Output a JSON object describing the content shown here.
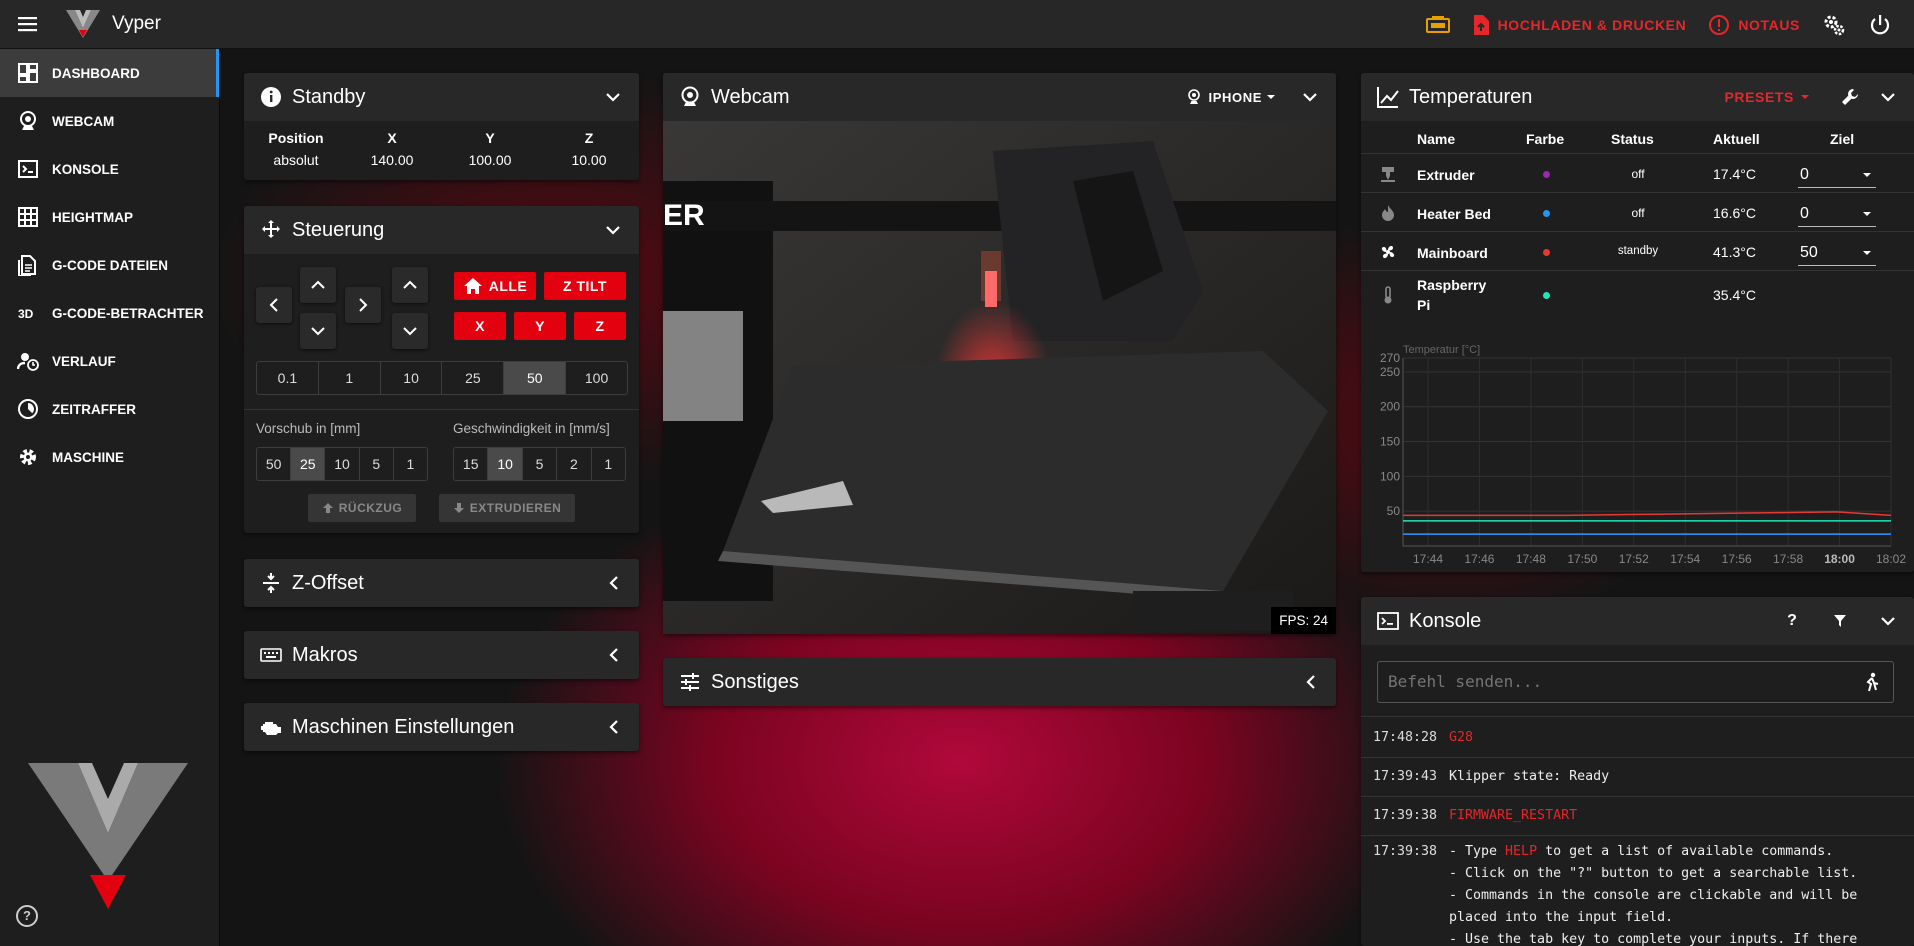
{
  "app": {
    "title": "Vyper"
  },
  "topbar": {
    "upload_print": "HOCHLADEN & DRUCKEN",
    "emergency": "NOTAUS"
  },
  "sidebar": {
    "items": [
      {
        "label": "DASHBOARD",
        "icon": "dashboard-icon"
      },
      {
        "label": "WEBCAM",
        "icon": "webcam-icon"
      },
      {
        "label": "KONSOLE",
        "icon": "console-icon"
      },
      {
        "label": "HEIGHTMAP",
        "icon": "grid-icon"
      },
      {
        "label": "G-CODE DATEIEN",
        "icon": "file-icon"
      },
      {
        "label": "G-CODE-BETRACHTER",
        "icon": "3d-icon"
      },
      {
        "label": "VERLAUF",
        "icon": "history-icon"
      },
      {
        "label": "ZEITRAFFER",
        "icon": "timelapse-icon"
      },
      {
        "label": "MASCHINE",
        "icon": "gear-icon"
      }
    ]
  },
  "standby": {
    "title": "Standby",
    "headers": [
      "Position",
      "X",
      "Y",
      "Z"
    ],
    "values": [
      "absolut",
      "140.00",
      "100.00",
      "10.00"
    ]
  },
  "steuerung": {
    "title": "Steuerung",
    "home_all": "ALLE",
    "z_tilt": "Z TILT",
    "x": "X",
    "y": "Y",
    "z": "Z",
    "steps": [
      "0.1",
      "1",
      "10",
      "25",
      "50",
      "100"
    ],
    "steps_selected": "50",
    "feed_label": "Vorschub in [mm]",
    "feed": [
      "50",
      "25",
      "10",
      "5",
      "1"
    ],
    "feed_selected": "25",
    "speed_label": "Geschwindigkeit in [mm/s]",
    "speed": [
      "15",
      "10",
      "5",
      "2",
      "1"
    ],
    "speed_selected": "10",
    "retract": "RÜCKZUG",
    "extrude": "EXTRUDIEREN"
  },
  "zoffset": {
    "title": "Z-Offset"
  },
  "makros": {
    "title": "Makros"
  },
  "machine_settings": {
    "title": "Maschinen Einstellungen"
  },
  "webcam": {
    "title": "Webcam",
    "camera": "IPHONE",
    "fps": "FPS: 24"
  },
  "sonstiges": {
    "title": "Sonstiges"
  },
  "temps": {
    "title": "Temperaturen",
    "presets": "PRESETS",
    "headers": [
      "Name",
      "Farbe",
      "Status",
      "Aktuell",
      "Ziel"
    ],
    "rows": [
      {
        "name": "Extruder",
        "color": "#9c27b0",
        "status": "off",
        "current": "17.4°C",
        "target": "0"
      },
      {
        "name": "Heater Bed",
        "color": "#2196f3",
        "status": "off",
        "current": "16.6°C",
        "target": "0"
      },
      {
        "name": "Mainboard",
        "color": "#e53935",
        "status": "standby",
        "current": "41.3°C",
        "target": "50"
      },
      {
        "name": "Raspberry Pi",
        "color": "#1de9b6",
        "status": "",
        "current": "35.4°C",
        "target": ""
      }
    ]
  },
  "chart_data": {
    "type": "line",
    "ylabel": "Temperatur [°C]",
    "ylim": [
      0,
      270
    ],
    "yticks": [
      "270",
      "250",
      "200",
      "150",
      "100",
      "50"
    ],
    "xticks": [
      "17:44",
      "17:46",
      "17:48",
      "17:50",
      "17:52",
      "17:54",
      "17:56",
      "17:58",
      "18:00",
      "18:02"
    ],
    "series": [
      {
        "name": "Mainboard",
        "color": "#e53935",
        "values": [
          44,
          44,
          44,
          44,
          45,
          46,
          47,
          48,
          49,
          44
        ]
      },
      {
        "name": "Raspberry Pi",
        "color": "#1de9b6",
        "values": [
          36,
          36,
          36,
          36,
          36,
          36,
          36,
          36,
          36,
          36
        ]
      },
      {
        "name": "Extruder",
        "color": "#9c27b0",
        "values": [
          17,
          17,
          17,
          17,
          17,
          17,
          17,
          17,
          17,
          17
        ]
      },
      {
        "name": "Heater Bed",
        "color": "#2196f3",
        "values": [
          17,
          17,
          17,
          17,
          17,
          17,
          17,
          17,
          17,
          17
        ]
      }
    ]
  },
  "console": {
    "title": "Konsole",
    "placeholder": "Befehl senden...",
    "lines": [
      {
        "time": "17:48:28",
        "text": "G28",
        "cmd": true
      },
      {
        "time": "17:39:43",
        "text": "Klipper state: Ready",
        "cmd": false
      },
      {
        "time": "17:39:38",
        "text": "FIRMWARE_RESTART",
        "cmd": true
      }
    ],
    "help": {
      "time": "17:39:38",
      "l1a": "- Type ",
      "l1b": "HELP",
      "l1c": " to get a list of available commands.",
      "l2": "- Click on the \"?\" button to get a searchable list.",
      "l3": "- Commands in the console are clickable and will be",
      "l4": "placed into the input field.",
      "l5": "- Use the tab key to complete your inputs. If there"
    }
  }
}
